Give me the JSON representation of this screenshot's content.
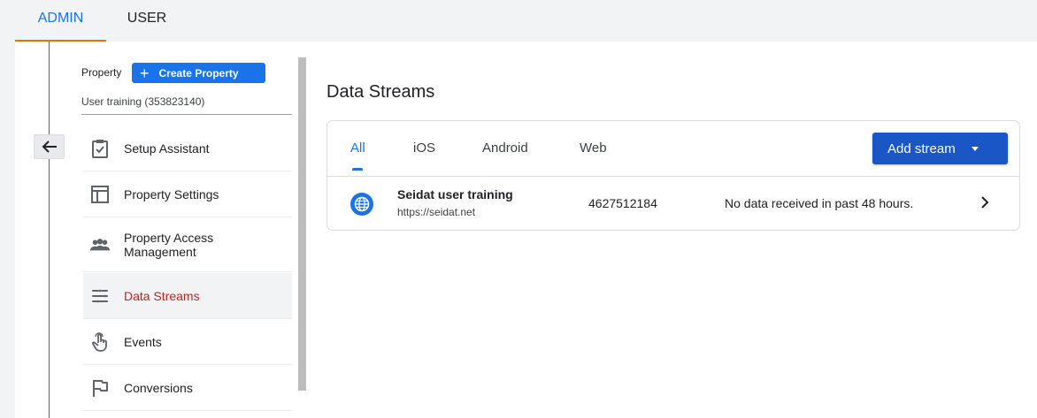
{
  "top_tabs": [
    {
      "label": "ADMIN",
      "active": true
    },
    {
      "label": "USER",
      "active": false
    }
  ],
  "property": {
    "label": "Property",
    "create_button": "Create Property",
    "name": "User training (353823140)"
  },
  "menu": [
    {
      "label": "Setup Assistant",
      "icon": "clipboard-check-icon"
    },
    {
      "label": "Property Settings",
      "icon": "layout-icon"
    },
    {
      "label": "Property Access Management",
      "icon": "people-icon"
    },
    {
      "label": "Data Streams",
      "icon": "streams-icon",
      "active": true
    },
    {
      "label": "Events",
      "icon": "touch-icon"
    },
    {
      "label": "Conversions",
      "icon": "flag-icon"
    }
  ],
  "page_title": "Data Streams",
  "stream_tabs": [
    {
      "label": "All",
      "active": true
    },
    {
      "label": "iOS"
    },
    {
      "label": "Android"
    },
    {
      "label": "Web"
    }
  ],
  "add_stream_label": "Add stream",
  "streams": [
    {
      "name": "Seidat user training",
      "url": "https://seidat.net",
      "id": "4627512184",
      "status": "No data received in past 48 hours.",
      "icon": "globe-icon"
    }
  ],
  "colors": {
    "accent": "#1a73e8",
    "admin_underline": "#e37400",
    "active_menu_text": "#c5221f",
    "add_stream_bg": "#1a56c5"
  }
}
